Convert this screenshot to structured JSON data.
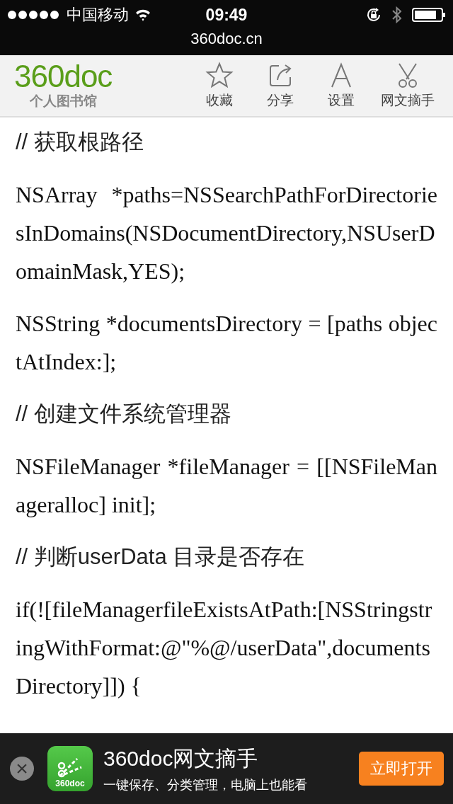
{
  "status_bar": {
    "carrier": "中国移动",
    "time": "09:49",
    "url": "360doc.cn"
  },
  "header": {
    "logo": "360doc",
    "logo_subtitle": "个人图书馆",
    "actions": [
      {
        "kind": "star",
        "label": "收藏"
      },
      {
        "kind": "share",
        "label": "分享"
      },
      {
        "kind": "font",
        "label": "设置"
      },
      {
        "kind": "scissors",
        "label": "网文摘手"
      }
    ]
  },
  "article": {
    "paragraphs": [
      {
        "kind": "comment",
        "text": "// 获取根路径"
      },
      {
        "kind": "code",
        "text": "NSArray *paths=NSSearchPathForDirectoriesInDomains(NSDocumentDirectory,NSUserDomainMask,YES);"
      },
      {
        "kind": "code",
        "text": "NSString *documentsDirectory = [paths objectAtIndex:];"
      },
      {
        "kind": "comment",
        "text": "// 创建文件系统管理器"
      },
      {
        "kind": "code",
        "text": "NSFileManager *fileManager = [[NSFileManageralloc] init];"
      },
      {
        "kind": "comment",
        "text": "// 判断userData 目录是否存在"
      },
      {
        "kind": "code",
        "text": "if(![fileManagerfileExistsAtPath:[NSStringstringWithFormat:@\"%@/userData\",documentsDirectory]]) {"
      }
    ]
  },
  "banner": {
    "close": "×",
    "app_icon_text": "360doc",
    "title": "360doc网文摘手",
    "subtitle": "一键保存、分类管理，电脑上也能看",
    "button": "立即打开"
  }
}
